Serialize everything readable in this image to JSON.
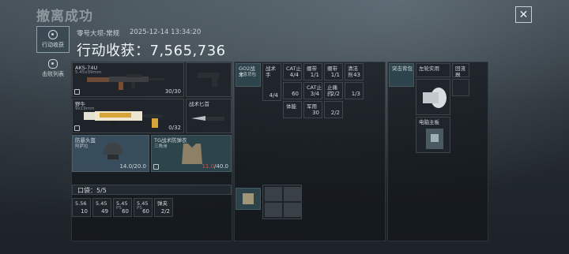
{
  "header": {
    "title": "撤离成功",
    "close_glyph": "✕"
  },
  "nav": [
    {
      "label": "行动收获",
      "icon": "target-icon"
    },
    {
      "label": "击败列表",
      "icon": "skull-icon"
    }
  ],
  "meta": {
    "map": "零号大坝-常规",
    "datetime": "2025-12-14 13:34:20"
  },
  "total": {
    "label": "行动收获：",
    "value": "7,565,736"
  },
  "equipment": {
    "primary": {
      "name": "AKS-74U",
      "sub": "5.45x39mm",
      "count": "30/30"
    },
    "secondary": {
      "name": "野牛",
      "sub": "9x19mm",
      "count": "0/32"
    },
    "melee": {
      "name": "战术匕首"
    },
    "helmet": {
      "name": "防暴头盔",
      "sub": "阿萨拉",
      "durability": "14.0/20.0"
    },
    "armor": {
      "name": "TG战术防弹衣",
      "sub": "三角洲",
      "durability_cur": "11.0",
      "durability_max": "/40.0"
    }
  },
  "pouch": {
    "label": "口袋：5/5",
    "items": [
      {
        "name": "5.56",
        "sub": "",
        "count": "10"
      },
      {
        "name": "5.45",
        "sub": "",
        "count": "49"
      },
      {
        "name": "5.45",
        "sub": "PS",
        "count": "60"
      },
      {
        "name": "5.45",
        "sub": "PS",
        "count": "60"
      },
      {
        "name": "弹夹",
        "sub": "",
        "count": "2/2"
      }
    ]
  },
  "rig": {
    "col_a": {
      "name": "GO2战术",
      "sub": "全息背包"
    },
    "items": [
      {
        "name": "战术手",
        "count": "4/4"
      },
      {
        "name": "CAT止",
        "count": "4/4"
      },
      {
        "name": "绷带",
        "count": "1/1"
      },
      {
        "name": "绷带",
        "count": "1/1"
      },
      {
        "name": "清洁剂",
        "count": "43"
      },
      {
        "name": "",
        "count": "60"
      },
      {
        "name": "CAT止",
        "count": "3/4"
      },
      {
        "name": "止痛药",
        "count": "2/2"
      },
      {
        "name": "",
        "count": "1/3"
      },
      {
        "name": "体能",
        "count": ""
      },
      {
        "name": "军用",
        "count": "30"
      },
      {
        "name": "",
        "count": "2/2"
      }
    ]
  },
  "bag": {
    "head": {
      "name": "突击背包"
    },
    "items": [
      {
        "name": "左轮实用"
      },
      {
        "name": "回流器"
      },
      {
        "name": "电脑主板"
      }
    ]
  },
  "colors": {
    "accent": "#cfd7dc",
    "danger": "#d44b3b"
  }
}
